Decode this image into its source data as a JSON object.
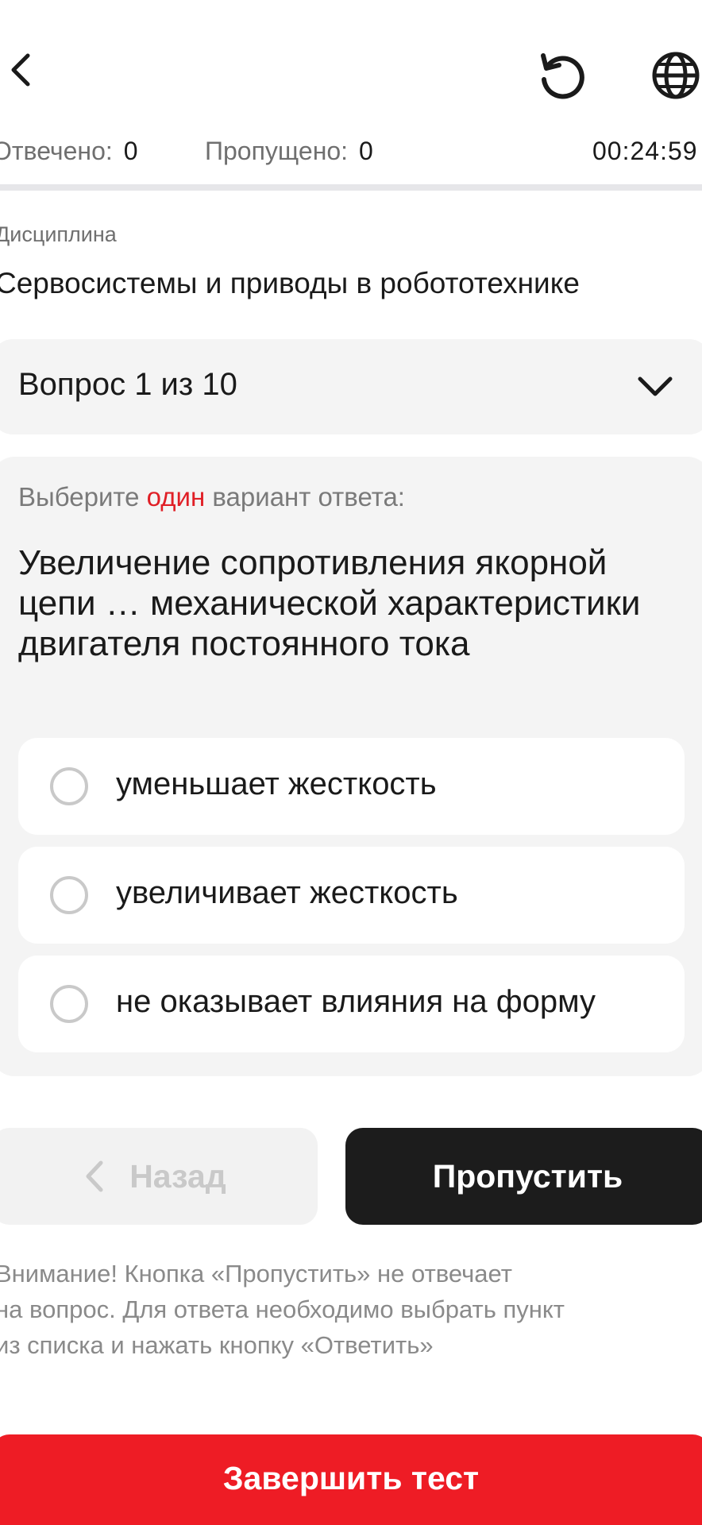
{
  "stats": {
    "answered_label": "Отвечено:",
    "answered_value": "0",
    "skipped_label": "Пропущено:",
    "skipped_value": "0",
    "timer": "00:24:59"
  },
  "discipline": {
    "label": "Дисциплина",
    "value": "Сервосистемы и приводы в робототехнике"
  },
  "question_selector": {
    "text": "Вопрос 1 из 10"
  },
  "question": {
    "instruction_pre": "Выберите",
    "instruction_highlight": "один",
    "instruction_post": "вариант ответа:",
    "text": "Увеличение сопротивления якорной цепи … механической характеристики двигателя постоянного тока",
    "options": [
      {
        "label": "уменьшает жесткость",
        "selected": false
      },
      {
        "label": "увеличивает жесткость",
        "selected": false
      },
      {
        "label": "не оказывает влияния на форму",
        "selected": false
      }
    ]
  },
  "buttons": {
    "back_label": "Назад",
    "skip_label": "Пропустить",
    "finish_label": "Завершить тест"
  },
  "notice": {
    "line1": "Внимание! Кнопка «Пропустить» не отвечает",
    "line2": "на вопрос. Для ответа необходимо выбрать пункт",
    "line3": "из списка и нажать кнопку «Ответить»"
  },
  "colors": {
    "accent": "#ee1c25",
    "highlight": "#e01f26",
    "dark_button": "#1c1c1c",
    "card_bg": "#f4f4f4"
  },
  "icons": {
    "back": "chevron-left-icon",
    "reload": "reload-icon",
    "language": "globe-icon",
    "dropdown": "chevron-down-icon"
  }
}
